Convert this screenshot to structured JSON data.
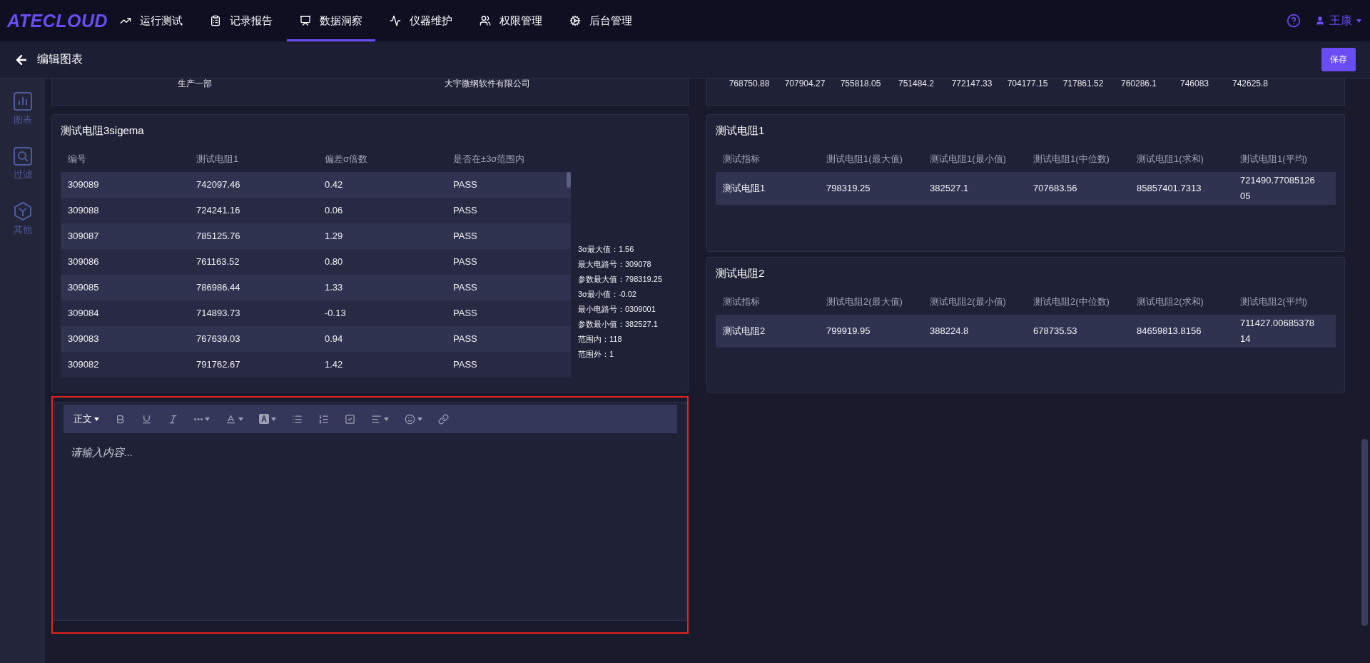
{
  "nav": {
    "logo": "ATECLOUD",
    "items": [
      {
        "label": "运行测试",
        "selected": false
      },
      {
        "label": "记录报告",
        "selected": false
      },
      {
        "label": "数据洞察",
        "selected": true
      },
      {
        "label": "仪器维护",
        "selected": false
      },
      {
        "label": "权限管理",
        "selected": false
      },
      {
        "label": "后台管理",
        "selected": false
      }
    ],
    "user": "王康"
  },
  "header": {
    "title": "编辑图表",
    "save": "保存"
  },
  "sidebar": [
    {
      "label": "图表"
    },
    {
      "label": "过滤"
    },
    {
      "label": "其他"
    }
  ],
  "left_top_partial": {
    "cells": [
      "生产一部",
      "大宇微纲软件有限公司"
    ]
  },
  "right_top_partial": {
    "cells": [
      "768750.88",
      "707904.27",
      "755818.05",
      "751484.2",
      "772147.33",
      "704177.15",
      "717861.52",
      "760286.1",
      "746083",
      "742625.8"
    ]
  },
  "sigma_card": {
    "title": "测试电阻3sigema",
    "columns": [
      "编号",
      "测试电阻1",
      "偏差σ倍数",
      "是否在±3σ范围内"
    ],
    "rows": [
      [
        "309089",
        "742097.46",
        "0.42",
        "PASS"
      ],
      [
        "309088",
        "724241.16",
        "0.06",
        "PASS"
      ],
      [
        "309087",
        "785125.76",
        "1.29",
        "PASS"
      ],
      [
        "309086",
        "761163.52",
        "0.80",
        "PASS"
      ],
      [
        "309085",
        "786986.44",
        "1.33",
        "PASS"
      ],
      [
        "309084",
        "714893.73",
        "-0.13",
        "PASS"
      ],
      [
        "309083",
        "767639.03",
        "0.94",
        "PASS"
      ],
      [
        "309082",
        "791762.67",
        "1.42",
        "PASS"
      ]
    ],
    "stats": [
      "3σ最大值：1.56",
      "最大电路号：309078",
      "参数最大值：798319.25",
      "3σ最小值：-0.02",
      "最小电路号：0309001",
      "参数最小值：382527.1",
      "范围内：118",
      "范围外：1"
    ]
  },
  "editor": {
    "format_label": "正文",
    "placeholder": "请输入内容..."
  },
  "stat_cards": [
    {
      "title": "测试电阻1",
      "columns": [
        "测试指标",
        "测试电阻1(最大值)",
        "测试电阻1(最小值)",
        "测试电阻1(中位数)",
        "测试电阻1(求和)",
        "测试电阻1(平均)"
      ],
      "rows": [
        [
          "测试电阻1",
          "798319.25",
          "382527.1",
          "707683.56",
          "85857401.7313",
          "721490.7708512605"
        ]
      ]
    },
    {
      "title": "测试电阻2",
      "columns": [
        "测试指标",
        "测试电阻2(最大值)",
        "测试电阻2(最小值)",
        "测试电阻2(中位数)",
        "测试电阻2(求和)",
        "测试电阻2(平均)"
      ],
      "rows": [
        [
          "测试电阻2",
          "799919.95",
          "388224.8",
          "678735.53",
          "84659813.8156",
          "711427.0068537814"
        ]
      ]
    }
  ]
}
